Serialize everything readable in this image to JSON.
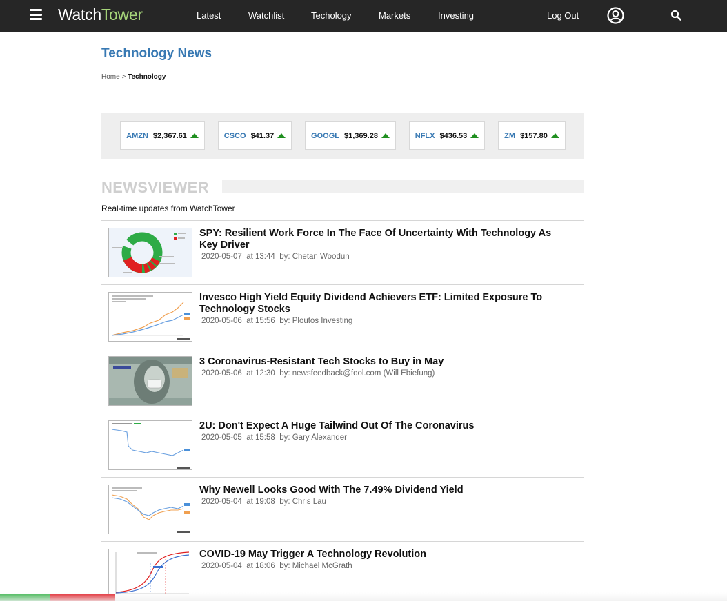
{
  "header": {
    "logo_part1": "Watch",
    "logo_part2": "Tower",
    "nav": [
      "Latest",
      "Watchlist",
      "Techology",
      "Markets",
      "Investing"
    ],
    "logout": "Log Out",
    "menu_icon": "hamburger-menu-icon",
    "user_icon": "user-account-icon",
    "search_icon": "search-icon"
  },
  "page": {
    "title": "Technology News",
    "breadcrumb_home": "Home",
    "breadcrumb_separator": ">",
    "breadcrumb_current": "Technology"
  },
  "tickers": [
    {
      "symbol": "AMZN",
      "price": "$2,367.61",
      "direction": "up"
    },
    {
      "symbol": "CSCO",
      "price": "$41.37",
      "direction": "up"
    },
    {
      "symbol": "GOOGL",
      "price": "$1,369.28",
      "direction": "up"
    },
    {
      "symbol": "NFLX",
      "price": "$436.53",
      "direction": "up"
    },
    {
      "symbol": "ZM",
      "price": "$157.80",
      "direction": "up"
    }
  ],
  "newsviewer": {
    "title": "NEWSVIEWER",
    "subtitle": "Real-time updates from WatchTower",
    "items": [
      {
        "headline": "SPY: Resilient Work Force In The Face Of Uncertainty With Technology As Key Driver",
        "date": "2020-05-07",
        "time": "at 13:44",
        "by": "by: Chetan Woodun"
      },
      {
        "headline": "Invesco High Yield Equity Dividend Achievers ETF: Limited Exposure To Technology Stocks",
        "date": "2020-05-06",
        "time": "at 15:56",
        "by": "by: Ploutos Investing"
      },
      {
        "headline": "3 Coronavirus-Resistant Tech Stocks to Buy in May",
        "date": "2020-05-06",
        "time": "at 12:30",
        "by": "by: newsfeedback@fool.com (Will Ebiefung)"
      },
      {
        "headline": "2U: Don't Expect A Huge Tailwind Out Of The Coronavirus",
        "date": "2020-05-05",
        "time": "at 15:58",
        "by": "by: Gary Alexander"
      },
      {
        "headline": "Why Newell Looks Good With The 7.49% Dividend Yield",
        "date": "2020-05-04",
        "time": "at 19:08",
        "by": "by: Chris Lau"
      },
      {
        "headline": "COVID-19 May Trigger A Technology Revolution",
        "date": "2020-05-04",
        "time": "at 18:06",
        "by": "by: Michael McGrath"
      }
    ]
  },
  "colors": {
    "topbar": "#262626",
    "accent_blue": "#3879b3",
    "up_green": "#1f8f1f",
    "logo_green": "#a6d57a"
  }
}
